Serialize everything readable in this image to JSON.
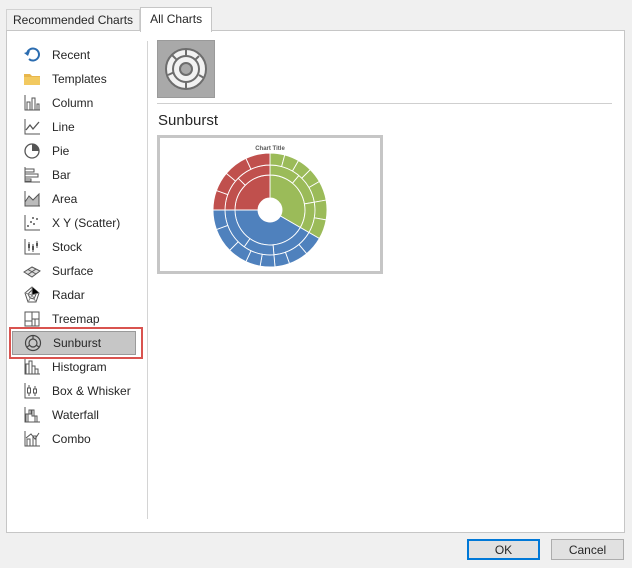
{
  "tabs": [
    {
      "label": "Recommended Charts",
      "active": false
    },
    {
      "label": "All Charts",
      "active": true
    }
  ],
  "chart_types": [
    {
      "label": "Recent",
      "icon": "recent-icon"
    },
    {
      "label": "Templates",
      "icon": "folder-icon"
    },
    {
      "label": "Column",
      "icon": "column-chart-icon"
    },
    {
      "label": "Line",
      "icon": "line-chart-icon"
    },
    {
      "label": "Pie",
      "icon": "pie-chart-icon"
    },
    {
      "label": "Bar",
      "icon": "bar-chart-icon"
    },
    {
      "label": "Area",
      "icon": "area-chart-icon"
    },
    {
      "label": "X Y (Scatter)",
      "icon": "scatter-chart-icon"
    },
    {
      "label": "Stock",
      "icon": "stock-chart-icon"
    },
    {
      "label": "Surface",
      "icon": "surface-chart-icon"
    },
    {
      "label": "Radar",
      "icon": "radar-chart-icon"
    },
    {
      "label": "Treemap",
      "icon": "treemap-chart-icon"
    },
    {
      "label": "Sunburst",
      "icon": "sunburst-chart-icon",
      "selected": true
    },
    {
      "label": "Histogram",
      "icon": "histogram-chart-icon"
    },
    {
      "label": "Box & Whisker",
      "icon": "box-whisker-chart-icon"
    },
    {
      "label": "Waterfall",
      "icon": "waterfall-chart-icon"
    },
    {
      "label": "Combo",
      "icon": "combo-chart-icon"
    }
  ],
  "selected_chart": {
    "title": "Sunburst",
    "preview_title": "Chart Title",
    "colors": {
      "red": "#c0504d",
      "green": "#9bbb59",
      "blue": "#4f81bd"
    }
  },
  "buttons": {
    "ok": "OK",
    "cancel": "Cancel"
  },
  "accent": "#0078d7",
  "highlight_color": "#d9534f"
}
